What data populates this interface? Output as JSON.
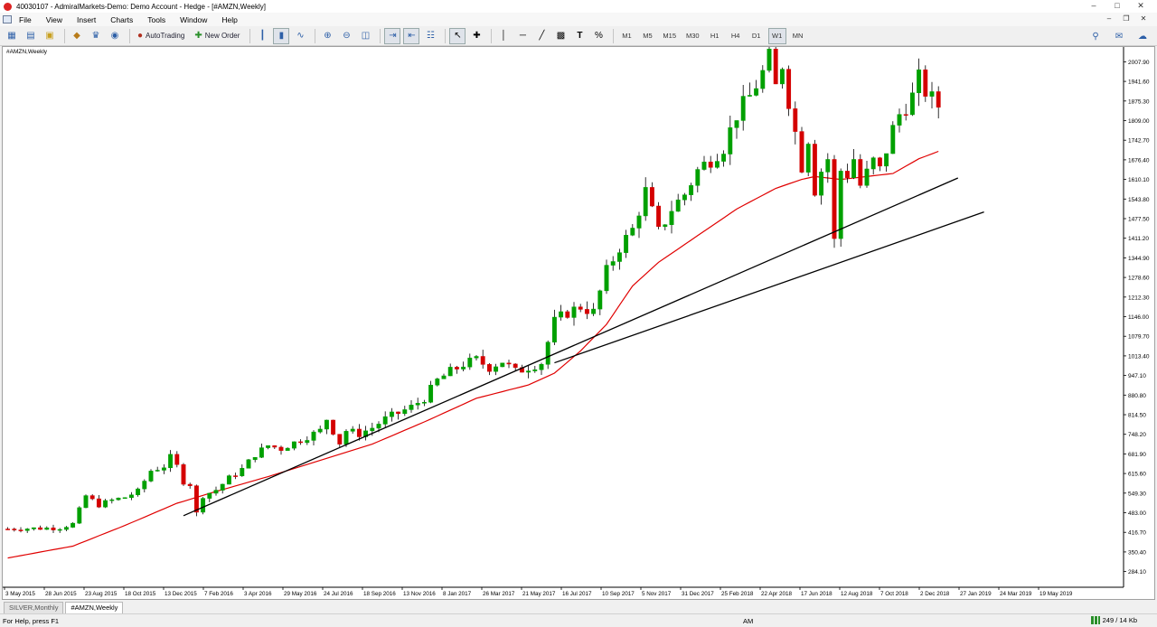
{
  "window": {
    "title": "40030107 - AdmiralMarkets-Demo: Demo Account - Hedge - [#AMZN,Weekly]"
  },
  "menu": {
    "items": [
      "File",
      "View",
      "Insert",
      "Charts",
      "Tools",
      "Window",
      "Help"
    ]
  },
  "toolbar": {
    "autotrading_label": "AutoTrading",
    "new_order_label": "New Order",
    "timeframes": [
      "M1",
      "M5",
      "M15",
      "M30",
      "H1",
      "H4",
      "D1",
      "W1",
      "MN"
    ],
    "active_timeframe": "W1"
  },
  "chart": {
    "label": "#AMZN,Weekly"
  },
  "chart_data": {
    "type": "candlestick",
    "symbol": "#AMZN",
    "timeframe": "Weekly",
    "y_ticks": [
      "2007.90",
      "1941.60",
      "1875.30",
      "1809.00",
      "1742.70",
      "1676.40",
      "1610.10",
      "1543.80",
      "1477.50",
      "1411.20",
      "1344.90",
      "1278.60",
      "1212.30",
      "1146.00",
      "1079.70",
      "1013.40",
      "947.10",
      "880.80",
      "814.50",
      "748.20",
      "681.90",
      "615.60",
      "549.30",
      "483.00",
      "416.70",
      "350.40",
      "284.10"
    ],
    "ylim": [
      231,
      2058
    ],
    "x_ticks": [
      "3 May 2015",
      "28 Jun 2015",
      "23 Aug 2015",
      "18 Oct 2015",
      "13 Dec 2015",
      "7 Feb 2016",
      "3 Apr 2016",
      "29 May 2016",
      "24 Jul 2016",
      "18 Sep 2016",
      "13 Nov 2016",
      "8 Jan 2017",
      "26 Mar 2017",
      "21 May 2017",
      "16 Jul 2017",
      "10 Sep 2017",
      "5 Nov 2017",
      "31 Dec 2017",
      "25 Feb 2018",
      "22 Apr 2018",
      "17 Jun 2018",
      "12 Aug 2018",
      "7 Oct 2018",
      "2 Dec 2018",
      "27 Jan 2019",
      "24 Mar 2019",
      "19 May 2019"
    ],
    "close_path": [
      [
        0,
        428
      ],
      [
        8,
        432
      ],
      [
        10,
        445
      ],
      [
        12,
        540
      ],
      [
        14,
        510
      ],
      [
        16,
        525
      ],
      [
        18,
        535
      ],
      [
        20,
        555
      ],
      [
        22,
        625
      ],
      [
        24,
        640
      ],
      [
        25,
        670
      ],
      [
        26,
        640
      ],
      [
        27,
        590
      ],
      [
        28,
        580
      ],
      [
        29,
        480
      ],
      [
        30,
        540
      ],
      [
        32,
        560
      ],
      [
        34,
        600
      ],
      [
        36,
        630
      ],
      [
        38,
        680
      ],
      [
        40,
        710
      ],
      [
        42,
        700
      ],
      [
        44,
        720
      ],
      [
        46,
        740
      ],
      [
        48,
        760
      ],
      [
        49,
        800
      ],
      [
        50,
        760
      ],
      [
        51,
        720
      ],
      [
        52,
        760
      ],
      [
        54,
        750
      ],
      [
        56,
        770
      ],
      [
        58,
        800
      ],
      [
        60,
        820
      ],
      [
        62,
        840
      ],
      [
        64,
        870
      ],
      [
        66,
        930
      ],
      [
        68,
        960
      ],
      [
        70,
        985
      ],
      [
        72,
        1000
      ],
      [
        74,
        975
      ],
      [
        76,
        995
      ],
      [
        78,
        960
      ],
      [
        80,
        975
      ],
      [
        82,
        990
      ],
      [
        84,
        1130
      ],
      [
        86,
        1160
      ],
      [
        88,
        1180
      ],
      [
        90,
        1160
      ],
      [
        92,
        1300
      ],
      [
        94,
        1380
      ],
      [
        96,
        1440
      ],
      [
        98,
        1570
      ],
      [
        100,
        1430
      ],
      [
        102,
        1510
      ],
      [
        104,
        1560
      ],
      [
        106,
        1640
      ],
      [
        108,
        1680
      ],
      [
        110,
        1720
      ],
      [
        112,
        1830
      ],
      [
        114,
        1890
      ],
      [
        116,
        1970
      ],
      [
        117,
        2020
      ],
      [
        118,
        1920
      ],
      [
        119,
        2000
      ],
      [
        120,
        1880
      ],
      [
        121,
        1770
      ],
      [
        122,
        1660
      ],
      [
        123,
        1750
      ],
      [
        124,
        1580
      ],
      [
        125,
        1640
      ],
      [
        126,
        1680
      ],
      [
        127,
        1400
      ],
      [
        128,
        1640
      ],
      [
        129,
        1630
      ],
      [
        130,
        1680
      ],
      [
        131,
        1590
      ],
      [
        132,
        1630
      ],
      [
        133,
        1670
      ],
      [
        134,
        1640
      ],
      [
        135,
        1710
      ],
      [
        136,
        1780
      ],
      [
        137,
        1830
      ],
      [
        138,
        1860
      ],
      [
        139,
        1890
      ],
      [
        140,
        1950
      ],
      [
        141,
        1910
      ],
      [
        142,
        1880
      ],
      [
        143,
        1860
      ]
    ],
    "ma_path": [
      [
        0,
        330
      ],
      [
        10,
        370
      ],
      [
        18,
        440
      ],
      [
        26,
        515
      ],
      [
        32,
        555
      ],
      [
        40,
        605
      ],
      [
        48,
        660
      ],
      [
        56,
        715
      ],
      [
        64,
        790
      ],
      [
        72,
        870
      ],
      [
        80,
        915
      ],
      [
        84,
        955
      ],
      [
        88,
        1030
      ],
      [
        92,
        1120
      ],
      [
        96,
        1250
      ],
      [
        100,
        1330
      ],
      [
        106,
        1420
      ],
      [
        112,
        1510
      ],
      [
        118,
        1580
      ],
      [
        122,
        1610
      ],
      [
        124,
        1620
      ],
      [
        128,
        1610
      ],
      [
        132,
        1620
      ],
      [
        136,
        1630
      ],
      [
        140,
        1680
      ],
      [
        143,
        1705
      ]
    ],
    "trendlines": [
      {
        "from": [
          27,
          473
        ],
        "to": [
          146,
          1615
        ]
      },
      {
        "from": [
          84,
          990
        ],
        "to": [
          150,
          1500
        ]
      }
    ],
    "series": [
      {
        "kind": "candles",
        "up_color": "#00a000",
        "down_color": "#d40000"
      },
      {
        "kind": "moving-average",
        "color": "#e00000"
      },
      {
        "kind": "trendline",
        "color": "#000000"
      }
    ],
    "grid": false
  },
  "tabs": {
    "items": [
      "SILVER,Monthly",
      "#AMZN,Weekly"
    ],
    "active": "#AMZN,Weekly"
  },
  "status": {
    "help": "For Help, press F1",
    "mode": "AM",
    "connection": "249 / 14 Kb"
  }
}
